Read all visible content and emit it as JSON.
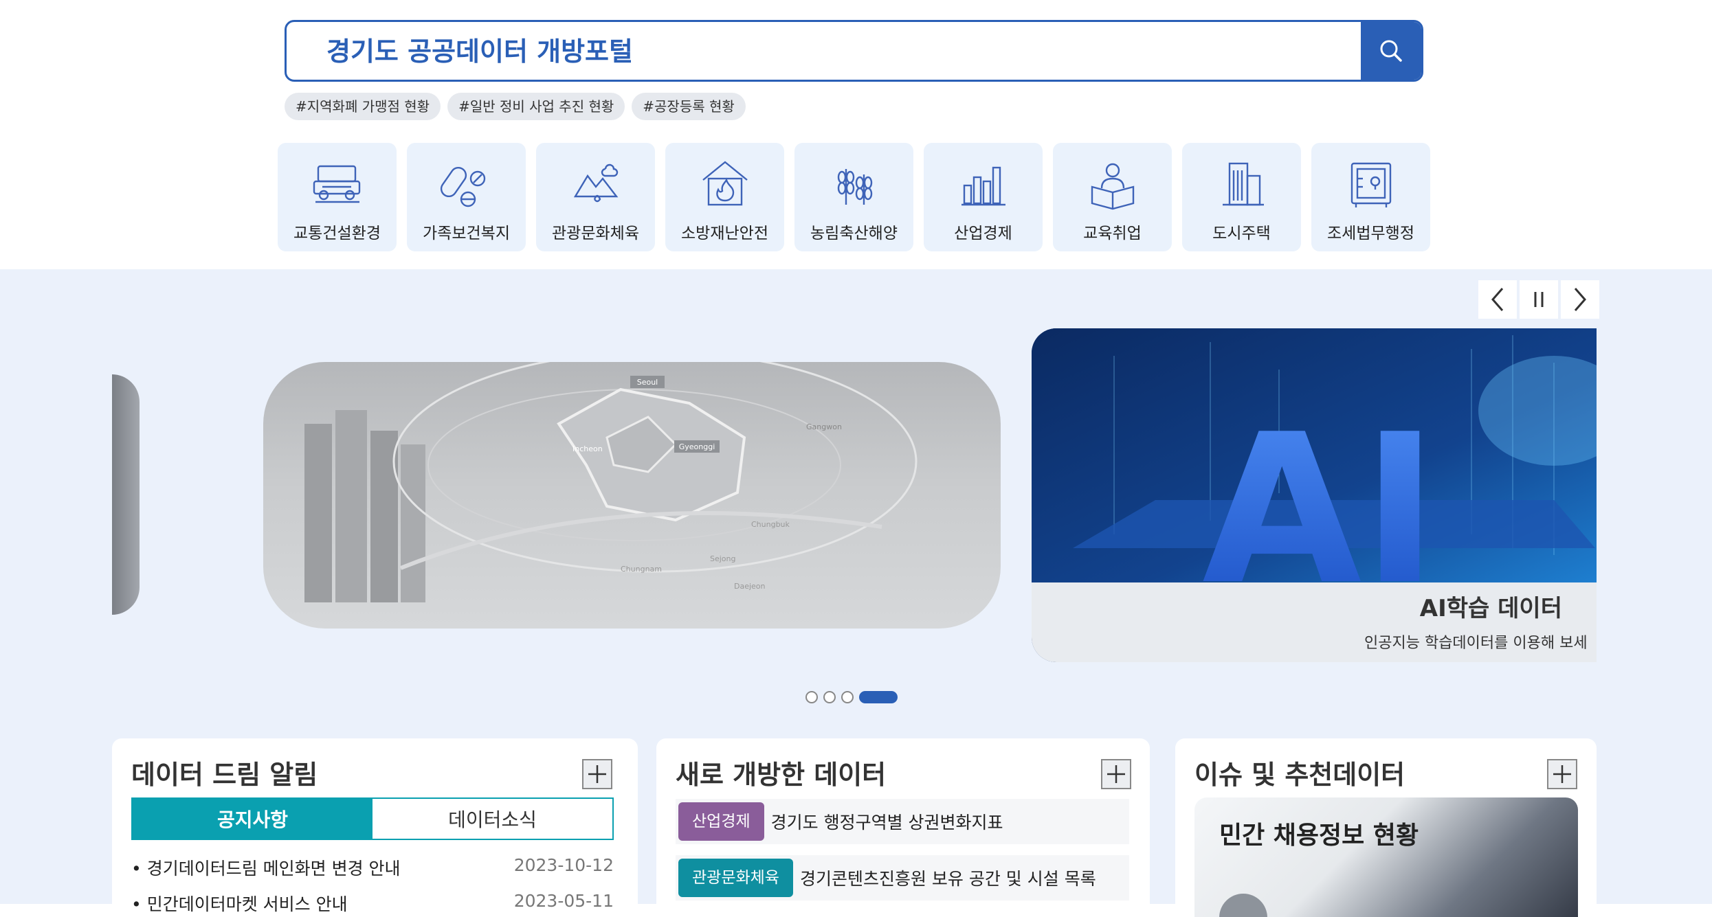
{
  "search": {
    "placeholder": "경기도 공공데이터 개방포털"
  },
  "tags": [
    "#지역화폐 가맹점 현황",
    "#일반 정비 사업 추진 현황",
    "#공장등록 현황"
  ],
  "categories": [
    {
      "label": "교통건설환경",
      "icon": "car-icon"
    },
    {
      "label": "가족보건복지",
      "icon": "pill-icon"
    },
    {
      "label": "관광문화체육",
      "icon": "landscape-icon"
    },
    {
      "label": "소방재난안전",
      "icon": "fire-icon"
    },
    {
      "label": "농림축산해양",
      "icon": "wheat-icon"
    },
    {
      "label": "산업경제",
      "icon": "bar-chart-icon"
    },
    {
      "label": "교육취업",
      "icon": "reading-person-icon"
    },
    {
      "label": "도시주택",
      "icon": "building-icon"
    },
    {
      "label": "조세법무행정",
      "icon": "safe-icon"
    }
  ],
  "carousel": {
    "controls": {
      "prev": "<",
      "pause": "II",
      "next": ">"
    },
    "map_labels": [
      "Seoul",
      "Incheon",
      "Gyeonggi",
      "Gangwon",
      "Chungbuk",
      "Chungnam",
      "Sejong",
      "Daejeon"
    ],
    "active_slide": {
      "image_text": "AI",
      "title": "AI학습 데이터",
      "description": "인공지능 학습데이터를 이용해 보세"
    },
    "dots": 4,
    "active_dot": 4
  },
  "panels": {
    "notice": {
      "title": "데이터 드림 알림",
      "tabs": [
        "공지사항",
        "데이터소식"
      ],
      "items": [
        {
          "title": "• 경기데이터드림 메인화면 변경 안내",
          "date": "2023-10-12"
        },
        {
          "title": "• 민간데이터마켓 서비스 안내",
          "date": "2023-05-11"
        }
      ]
    },
    "new_data": {
      "title": "새로 개방한 데이터",
      "items": [
        {
          "badge": "산업경제",
          "badge_color": "#8a5d9a",
          "title": "경기도 행정구역별 상권변화지표"
        },
        {
          "badge": "관광문화체육",
          "badge_color": "#0f8fa0",
          "title": "경기콘텐츠진흥원 보유 공간 및 시설 목록"
        }
      ]
    },
    "issue": {
      "title": "이슈 및 추천데이터",
      "image_caption": "민간 채용정보 현황"
    }
  },
  "colors": {
    "primary": "#2a5fb6",
    "teal": "#0aa0b0",
    "panel_bg": "#ebf1fb"
  }
}
